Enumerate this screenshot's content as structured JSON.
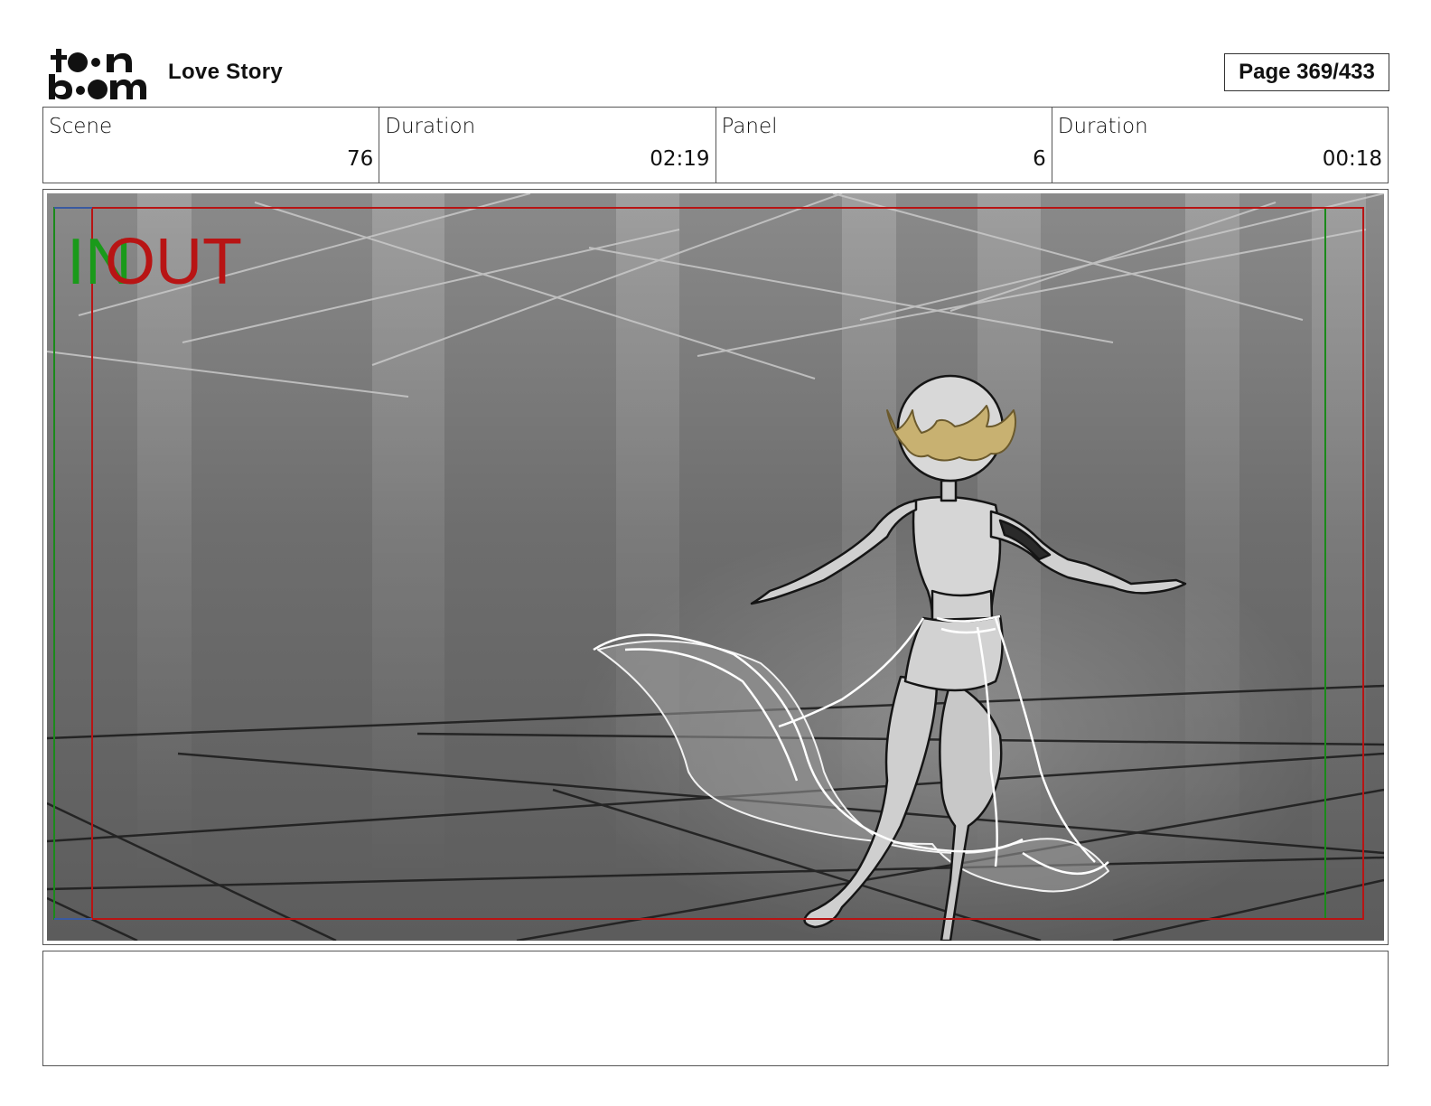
{
  "header": {
    "logo_text": "toon boom",
    "project_title": "Love Story",
    "page_label": "Page 369/433"
  },
  "info": {
    "scene_label": "Scene",
    "scene_value": "76",
    "scene_duration_label": "Duration",
    "scene_duration_value": "02:19",
    "panel_label": "Panel",
    "panel_value": "6",
    "panel_duration_label": "Duration",
    "panel_duration_value": "00:18"
  },
  "panel": {
    "in_marker": "IN",
    "out_marker": "OUT",
    "in_color": "#1a9a1a",
    "out_color": "#b81414"
  },
  "notes": {
    "text": ""
  }
}
